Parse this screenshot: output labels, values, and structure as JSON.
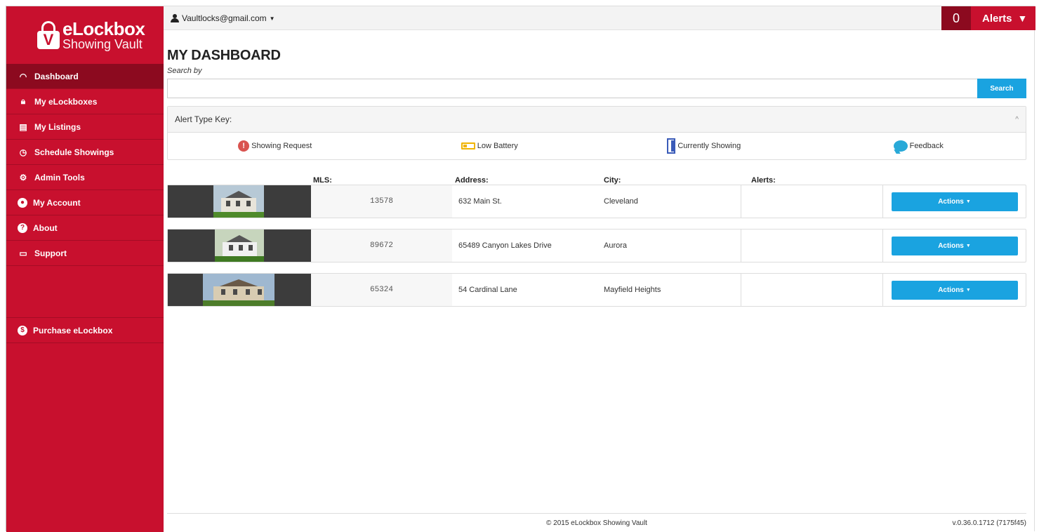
{
  "brand": {
    "name": "eLockbox",
    "tagline": "Showing Vault",
    "lock_letter": "V"
  },
  "sidebar": {
    "items": [
      {
        "label": "Dashboard",
        "icon": "gauge-icon",
        "active": true
      },
      {
        "label": "My eLockboxes",
        "icon": "lock-icon"
      },
      {
        "label": "My Listings",
        "icon": "document-icon"
      },
      {
        "label": "Schedule Showings",
        "icon": "clock-icon"
      },
      {
        "label": "Admin Tools",
        "icon": "gear-icon"
      },
      {
        "label": "My Account",
        "icon": "user-icon"
      },
      {
        "label": "About",
        "icon": "question-icon"
      },
      {
        "label": "Support",
        "icon": "book-icon"
      }
    ],
    "purchase": {
      "label": "Purchase eLockbox",
      "icon": "dollar-icon"
    }
  },
  "topbar": {
    "user_email": "Vaultlocks@gmail.com",
    "alert_count": "0",
    "alerts_label": "Alerts"
  },
  "main": {
    "title": "MY DASHBOARD",
    "search_label": "Search by",
    "search_value": "",
    "search_button": "Search",
    "alert_key": {
      "title": "Alert Type Key:",
      "types": [
        {
          "label": "Showing Request",
          "icon": "exclamation-icon",
          "color": "#d9534f"
        },
        {
          "label": "Low Battery",
          "icon": "battery-icon",
          "color": "#f0b400"
        },
        {
          "label": "Currently Showing",
          "icon": "door-icon",
          "color": "#3a5bb8"
        },
        {
          "label": "Feedback",
          "icon": "speech-bubble-icon",
          "color": "#29a9d8"
        }
      ]
    },
    "columns": {
      "mls": "MLS:",
      "address": "Address:",
      "city": "City:",
      "alerts": "Alerts:"
    },
    "listings": [
      {
        "mls": "13578",
        "address": "632 Main St.",
        "city": "Cleveland",
        "alerts": "",
        "action": "Actions"
      },
      {
        "mls": "89672",
        "address": "65489 Canyon Lakes Drive",
        "city": "Aurora",
        "alerts": "",
        "action": "Actions"
      },
      {
        "mls": "65324",
        "address": "54 Cardinal Lane",
        "city": "Mayfield Heights",
        "alerts": "",
        "action": "Actions"
      }
    ]
  },
  "footer": {
    "copyright": "© 2015 eLockbox Showing Vault",
    "version": "v.0.36.0.1712 (7175f45)"
  },
  "colors": {
    "brand_red": "#c8102e",
    "dark_red": "#8c0a1f",
    "accent_blue": "#1aa3e0"
  }
}
